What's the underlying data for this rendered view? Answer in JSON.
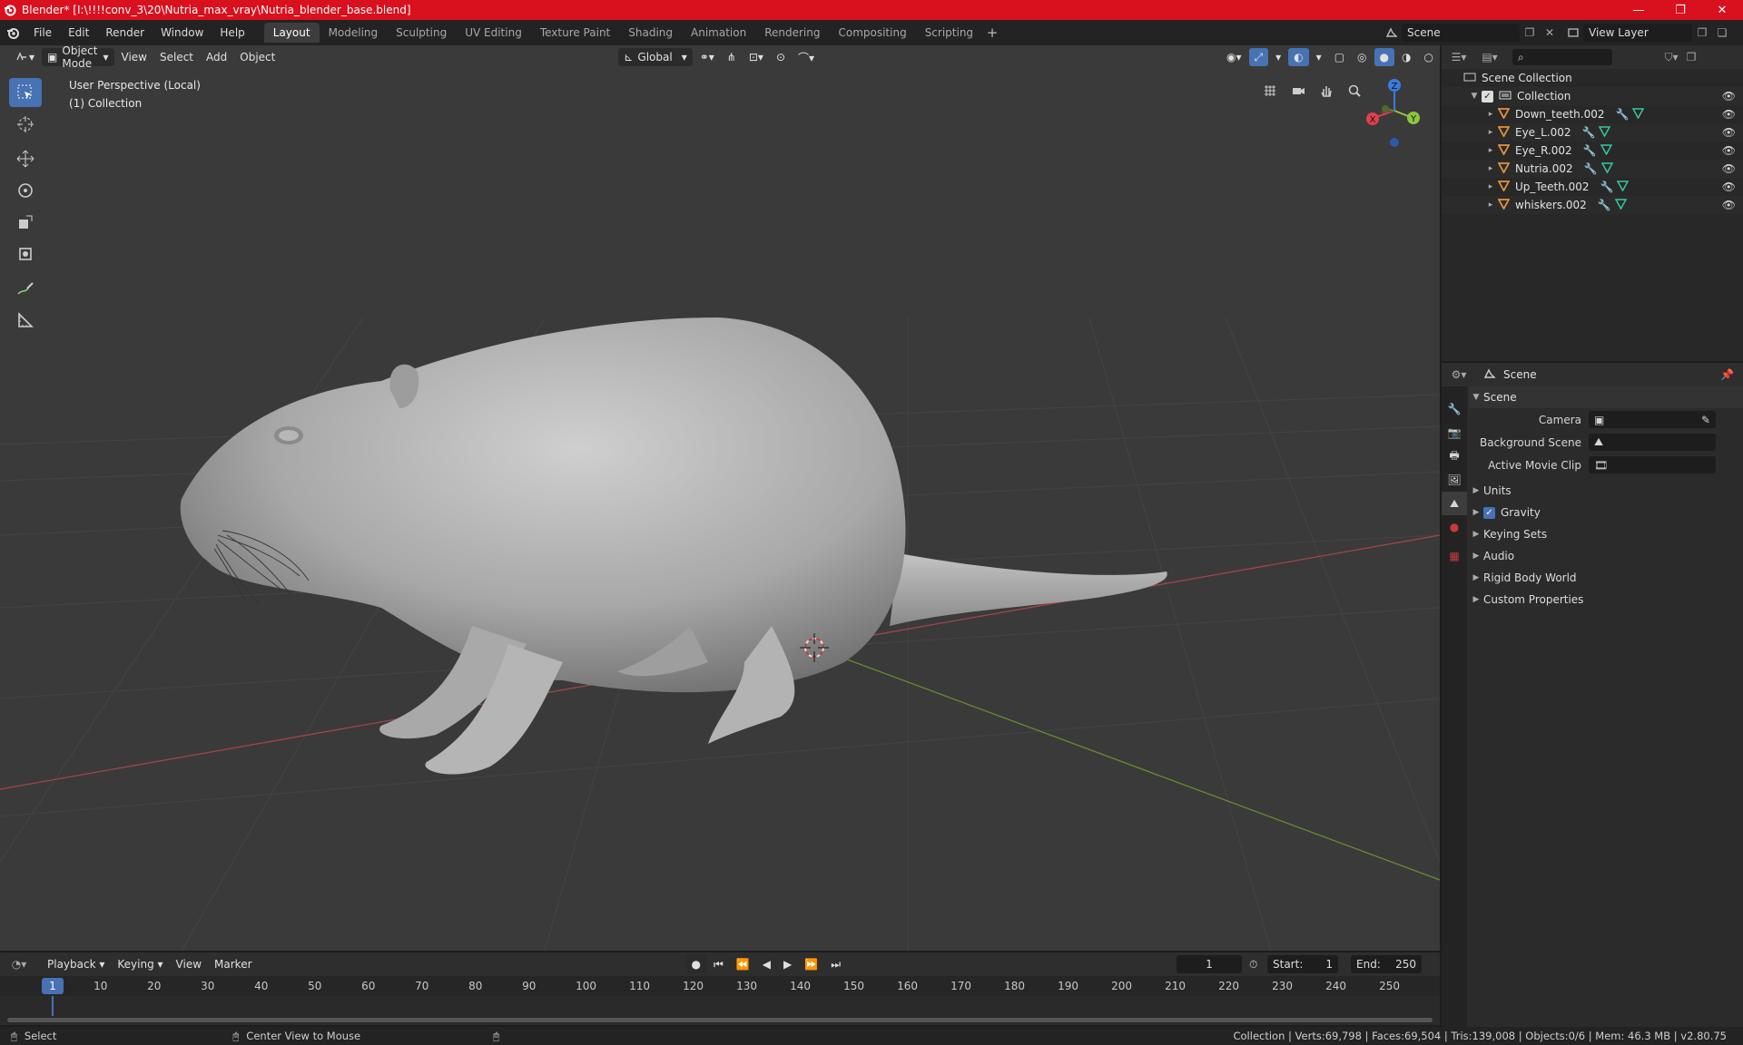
{
  "window": {
    "title": "Blender* [I:\\!!!!conv_3\\20\\Nutria_max_vray\\Nutria_blender_base.blend]",
    "minimize": "—",
    "maximize": "❐",
    "close": "✕"
  },
  "menu": [
    "File",
    "Edit",
    "Render",
    "Window",
    "Help"
  ],
  "workspaces": [
    "Layout",
    "Modeling",
    "Sculpting",
    "UV Editing",
    "Texture Paint",
    "Shading",
    "Animation",
    "Rendering",
    "Compositing",
    "Scripting"
  ],
  "active_workspace": "Layout",
  "add_workspace": "+",
  "scene_name": "Scene",
  "view_layer": "View Layer",
  "viewport": {
    "mode": "Object Mode",
    "menus": [
      "View",
      "Select",
      "Add",
      "Object"
    ],
    "orientation": "Global",
    "info_line1": "User Perspective (Local)",
    "info_line2": "(1) Collection",
    "axis_z": "Z",
    "axis_y": "Y",
    "axis_x": "X"
  },
  "outliner": {
    "root": "Scene Collection",
    "collection": "Collection",
    "objects": [
      "Down_teeth.002",
      "Eye_L.002",
      "Eye_R.002",
      "Nutria.002",
      "Up_Teeth.002",
      "whiskers.002"
    ]
  },
  "properties": {
    "header": "Scene",
    "panel": "Scene",
    "rows": [
      {
        "label": "Camera",
        "value": ""
      },
      {
        "label": "Background Scene",
        "value": ""
      },
      {
        "label": "Active Movie Clip",
        "value": ""
      }
    ],
    "subpanels": [
      "Units",
      "Gravity",
      "Keying Sets",
      "Audio",
      "Rigid Body World",
      "Custom Properties"
    ]
  },
  "timeline": {
    "menus": [
      "Playback",
      "Keying",
      "View",
      "Marker"
    ],
    "current_frame": "1",
    "start_label": "Start:",
    "start": "1",
    "end_label": "End:",
    "end": "250",
    "ticks": [
      "1",
      "10",
      "20",
      "30",
      "40",
      "50",
      "60",
      "70",
      "80",
      "90",
      "100",
      "110",
      "120",
      "130",
      "140",
      "150",
      "160",
      "170",
      "180",
      "190",
      "200",
      "210",
      "220",
      "230",
      "240",
      "250"
    ]
  },
  "statusbar": {
    "select": "Select",
    "center": "Center View to Mouse",
    "stats": "Collection | Verts:69,798 | Faces:69,504 | Tris:139,008 | Objects:0/6 | Mem: 46.3 MB | v2.80.75"
  },
  "colors": {
    "titlebar": "#d9101e",
    "accent": "#4772b3",
    "object_icon": "#e8913a",
    "modifier_icon": "#5d9cec",
    "mesh_icon": "#36c6a0"
  }
}
